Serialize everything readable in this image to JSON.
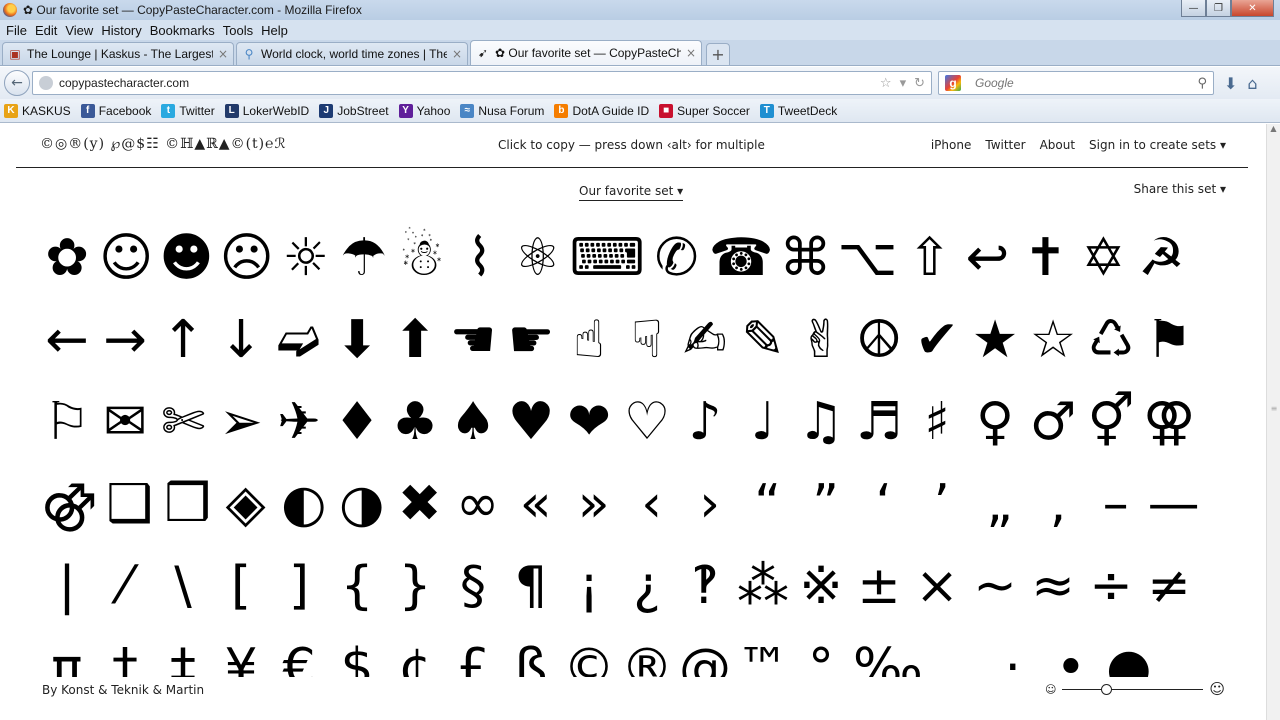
{
  "window": {
    "title": "✿ Our favorite set — CopyPasteCharacter.com - Mozilla Firefox",
    "min": "—",
    "max": "❐",
    "close": "✕"
  },
  "menu": [
    "File",
    "Edit",
    "View",
    "History",
    "Bookmarks",
    "Tools",
    "Help"
  ],
  "tabs": [
    {
      "label": "The Lounge | Kaskus - The Largest In...",
      "icon": "▣",
      "close": "×"
    },
    {
      "label": "World clock, world time zones | The T...",
      "icon": "⚲",
      "close": "×"
    },
    {
      "label": "✿ Our favorite set — CopyPasteChar...",
      "icon": "➹",
      "close": "×"
    }
  ],
  "new_tab": "+",
  "nav": {
    "back": "←",
    "url": "copypastecharacter.com",
    "url_icons": [
      "☆",
      "▾",
      "↻"
    ],
    "search_placeholder": "Google",
    "search_engine_letter": "g",
    "search_icon": "⚲",
    "download": "⬇",
    "home": "⌂"
  },
  "bookmarks": [
    {
      "label": "KASKUS",
      "icon": "K",
      "color": "#e8a317"
    },
    {
      "label": "Facebook",
      "icon": "f",
      "color": "#3b5998"
    },
    {
      "label": "Twitter",
      "icon": "t",
      "color": "#2aa9e0"
    },
    {
      "label": "LokerWebID",
      "icon": "L",
      "color": "#223a6a"
    },
    {
      "label": "JobStreet",
      "icon": "J",
      "color": "#1d3b73"
    },
    {
      "label": "Yahoo",
      "icon": "Y",
      "color": "#5f1f9a"
    },
    {
      "label": "Nusa Forum",
      "icon": "≈",
      "color": "#4a86c5"
    },
    {
      "label": "DotA Guide ID",
      "icon": "b",
      "color": "#f57d00"
    },
    {
      "label": "Super Soccer",
      "icon": "■",
      "color": "#c8102e"
    },
    {
      "label": "TweetDeck",
      "icon": "T",
      "color": "#1f8fd1"
    }
  ],
  "page": {
    "logo": "©◎®(y) ℘@$☷ ©ℍ▲ℝ▲©(t)℮ℛ",
    "tagline": "Click to copy — press down ‹alt› for multiple",
    "nav": [
      "iPhone",
      "Twitter",
      "About",
      "Sign in to create sets ▾"
    ],
    "set_select": "Our favorite set ▾",
    "share": "Share this set ▾",
    "characters": [
      "✿",
      "☺",
      "☻",
      "☹",
      "☼",
      "☂",
      "☃",
      "⌇",
      "⚛",
      "⌨",
      "✆",
      "☎",
      "⌘",
      "⌥",
      "⇧",
      "↩",
      "✝",
      "✡",
      "☭",
      "←",
      "→",
      "↑",
      "↓",
      "➫",
      "⬇",
      "⬆",
      "☚",
      "☛",
      "☝",
      "☟",
      "✍",
      "✎",
      "✌",
      "☮",
      "✔",
      "★",
      "☆",
      "♺",
      "⚑",
      "⚐",
      "✉",
      "✄",
      "➢",
      "✈",
      "♦",
      "♣",
      "♠",
      "♥",
      "❤",
      "♡",
      "♪",
      "♩",
      "♫",
      "♬",
      "♯",
      "♀",
      "♂",
      "⚥",
      "⚢",
      "⚣",
      "❑",
      "❒",
      "◈",
      "◐",
      "◑",
      "✖",
      "∞",
      "«",
      "»",
      "‹",
      "›",
      "“",
      "”",
      "‘",
      "’",
      "„",
      "‚",
      "–",
      "—",
      "|",
      "⁄",
      "\\",
      "[",
      "]",
      "{",
      "}",
      "§",
      "¶",
      "¡",
      "¿",
      "‽",
      "⁂",
      "※",
      "±",
      "×",
      "~",
      "≈",
      "÷",
      "≠",
      "π",
      "†",
      "‡",
      "¥",
      "€",
      "$",
      "¢",
      "£",
      "ß",
      "©",
      "®",
      "@",
      "™",
      "°",
      "‰",
      "…",
      "·",
      "•",
      "●"
    ],
    "footer": "By Konst & Teknik & Martin",
    "zoom": {
      "small": "☺",
      "large": "☺",
      "level": 0.31
    }
  }
}
